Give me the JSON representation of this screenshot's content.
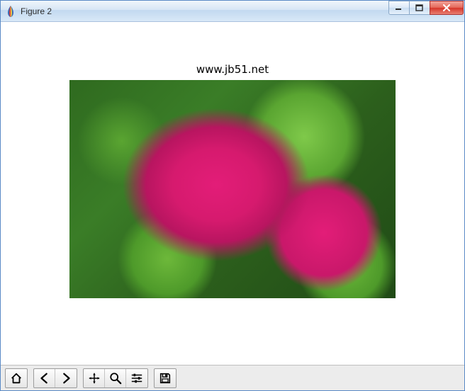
{
  "window": {
    "title": "Figure 2",
    "controls": {
      "minimize": "minimize",
      "maximize": "maximize",
      "close": "close"
    }
  },
  "plot": {
    "title": "www.jb51.net",
    "image_description": "pink peony flower with green leaves"
  },
  "toolbar": {
    "home": "home",
    "back": "back",
    "forward": "forward",
    "pan": "pan",
    "zoom": "zoom",
    "configure": "configure subplots",
    "save": "save"
  }
}
